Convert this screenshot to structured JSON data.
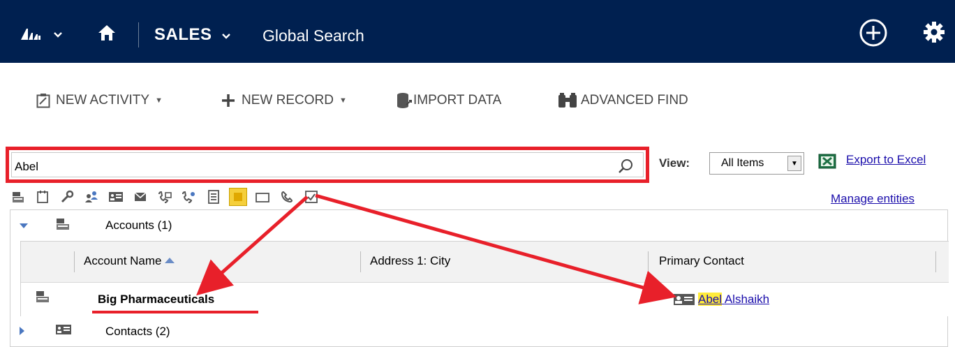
{
  "nav": {
    "module": "SALES",
    "page_title": "Global Search"
  },
  "commands": {
    "new_activity": "NEW ACTIVITY",
    "new_record": "NEW RECORD",
    "import_data": "IMPORT DATA",
    "advanced_find": "ADVANCED FIND"
  },
  "search": {
    "value": "Abel"
  },
  "view": {
    "label": "View:",
    "selected": "All Items"
  },
  "links": {
    "export": "Export to Excel",
    "manage": "Manage entities"
  },
  "groups": [
    {
      "name": "Accounts (1)",
      "expanded": true,
      "columns": [
        "Account Name",
        "Address 1: City",
        "Primary Contact"
      ],
      "sort_column": "Account Name",
      "rows": [
        {
          "account_name": "Big Pharmaceuticals",
          "city": "",
          "primary_contact_highlight": "Abel",
          "primary_contact_rest": "Alshaikh"
        }
      ]
    },
    {
      "name": "Contacts (2)",
      "expanded": false
    }
  ],
  "colors": {
    "nav_bg": "#002050",
    "annotation_red": "#e8202a",
    "link_blue": "#1a0dab",
    "highlight_yellow": "#ffeb3b"
  }
}
